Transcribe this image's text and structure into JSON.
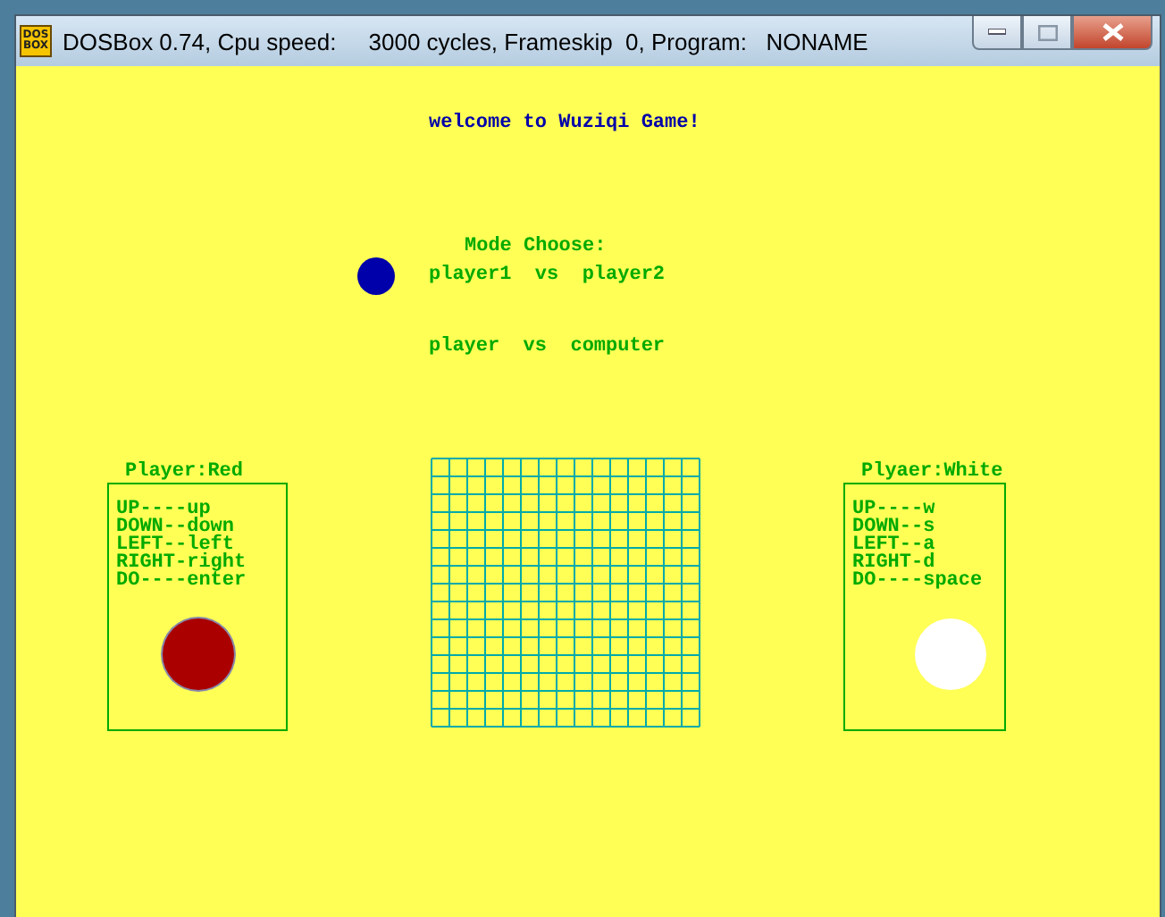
{
  "window": {
    "title": "DOSBox 0.74, Cpu speed:     3000 cycles, Frameskip  0, Program:   NONAME",
    "icon_text": [
      "DOS",
      "BOX"
    ]
  },
  "welcome": "welcome to Wuziqi Game!",
  "mode": {
    "heading": "Mode Choose:",
    "options": [
      {
        "label": "player1  vs  player2",
        "selected": true
      },
      {
        "label": "player  vs  computer",
        "selected": false
      }
    ]
  },
  "players": [
    {
      "label": "Player:Red",
      "keys": [
        "UP----up",
        "DOWN--down",
        "LEFT--left",
        "RIGHT-right",
        "DO----enter"
      ],
      "color": "#aa0000"
    },
    {
      "label": "Plyaer:White",
      "keys": [
        "UP----w",
        "DOWN--s",
        "LEFT--a",
        "RIGHT-d",
        "DO----space"
      ],
      "color": "#ffffff"
    }
  ]
}
